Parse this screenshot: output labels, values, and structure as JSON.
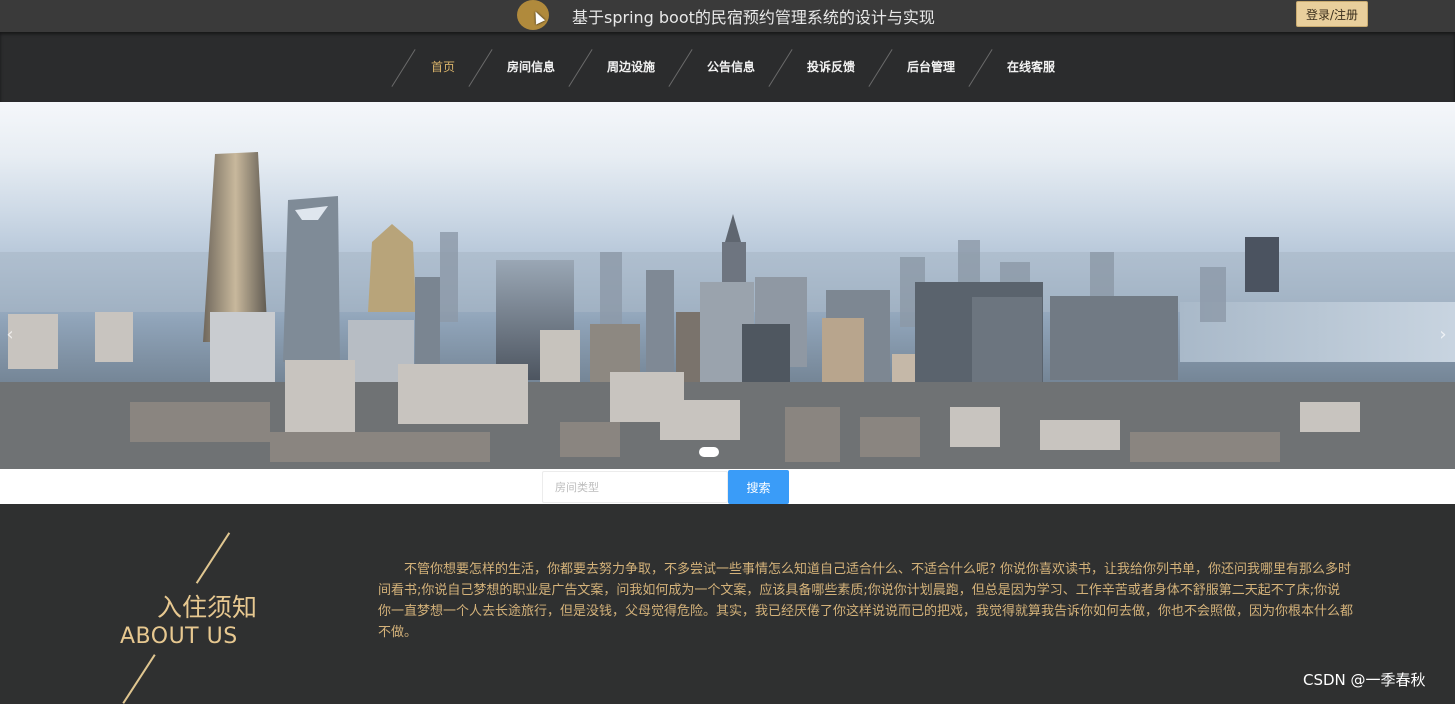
{
  "header": {
    "site_title": "基于spring boot的民宿预约管理系统的设计与实现",
    "login_label": "登录/注册"
  },
  "nav": {
    "items": [
      {
        "label": "首页",
        "active": true
      },
      {
        "label": "房间信息"
      },
      {
        "label": "周边设施"
      },
      {
        "label": "公告信息"
      },
      {
        "label": "投诉反馈"
      },
      {
        "label": "后台管理"
      },
      {
        "label": "在线客服"
      }
    ]
  },
  "banner": {
    "prev_icon": "chevron-left-icon",
    "next_icon": "chevron-right-icon",
    "prev_glyph": "‹",
    "next_glyph": "›"
  },
  "search": {
    "placeholder": "房间类型",
    "button_label": "搜索"
  },
  "about": {
    "title_cn": "入住须知",
    "title_en": "ABOUT US",
    "text": "不管你想要怎样的生活，你都要去努力争取，不多尝试一些事情怎么知道自己适合什么、不适合什么呢? 你说你喜欢读书，让我给你列书单，你还问我哪里有那么多时间看书;你说自己梦想的职业是广告文案，问我如何成为一个文案，应该具备哪些素质;你说你计划晨跑，但总是因为学习、工作辛苦或者身体不舒服第二天起不了床;你说你一直梦想一个人去长途旅行，但是没钱，父母觉得危险。其实，我已经厌倦了你这样说说而已的把戏，我觉得就算我告诉你如何去做，你也不会照做，因为你根本什么都不做。"
  },
  "watermark": "CSDN @一季春秋",
  "colors": {
    "accent_gold": "#e7c890",
    "search_button": "#3a9cf8",
    "login_button": "#e9cf9c"
  }
}
